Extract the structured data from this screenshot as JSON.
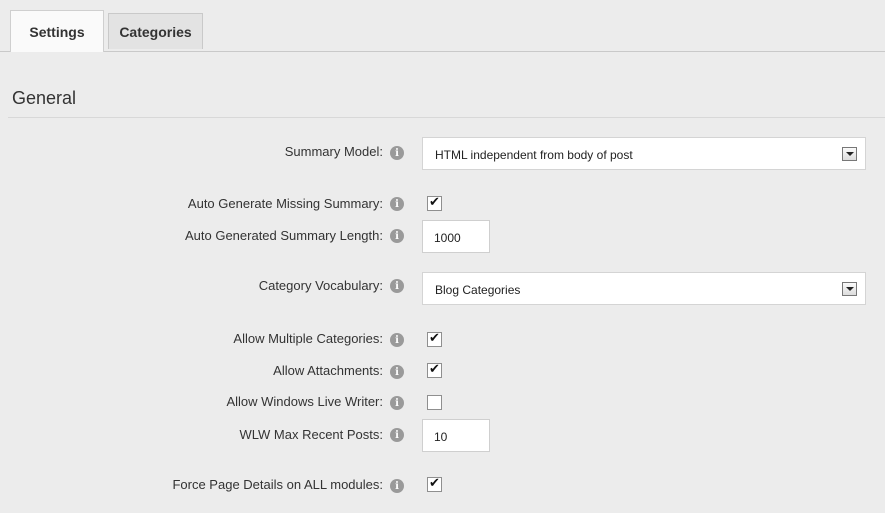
{
  "tabs": [
    {
      "label": "Settings",
      "active": true
    },
    {
      "label": "Categories",
      "active": false
    }
  ],
  "section": {
    "title": "General"
  },
  "info_icon": "info-icon",
  "fields": {
    "summary_model": {
      "label": "Summary Model:",
      "value": "HTML independent from body of post"
    },
    "auto_generate_missing_summary": {
      "label": "Auto Generate Missing Summary:",
      "checked": true
    },
    "auto_generated_summary_length": {
      "label": "Auto Generated Summary Length:",
      "value": "1000"
    },
    "category_vocabulary": {
      "label": "Category Vocabulary:",
      "value": "Blog Categories"
    },
    "allow_multiple_categories": {
      "label": "Allow Multiple Categories:",
      "checked": true
    },
    "allow_attachments": {
      "label": "Allow Attachments:",
      "checked": true
    },
    "allow_windows_live_writer": {
      "label": "Allow Windows Live Writer:",
      "checked": false
    },
    "wlw_max_recent_posts": {
      "label": "WLW Max Recent Posts:",
      "value": "10"
    },
    "force_page_details": {
      "label": "Force Page Details on ALL modules:",
      "checked": true
    }
  }
}
